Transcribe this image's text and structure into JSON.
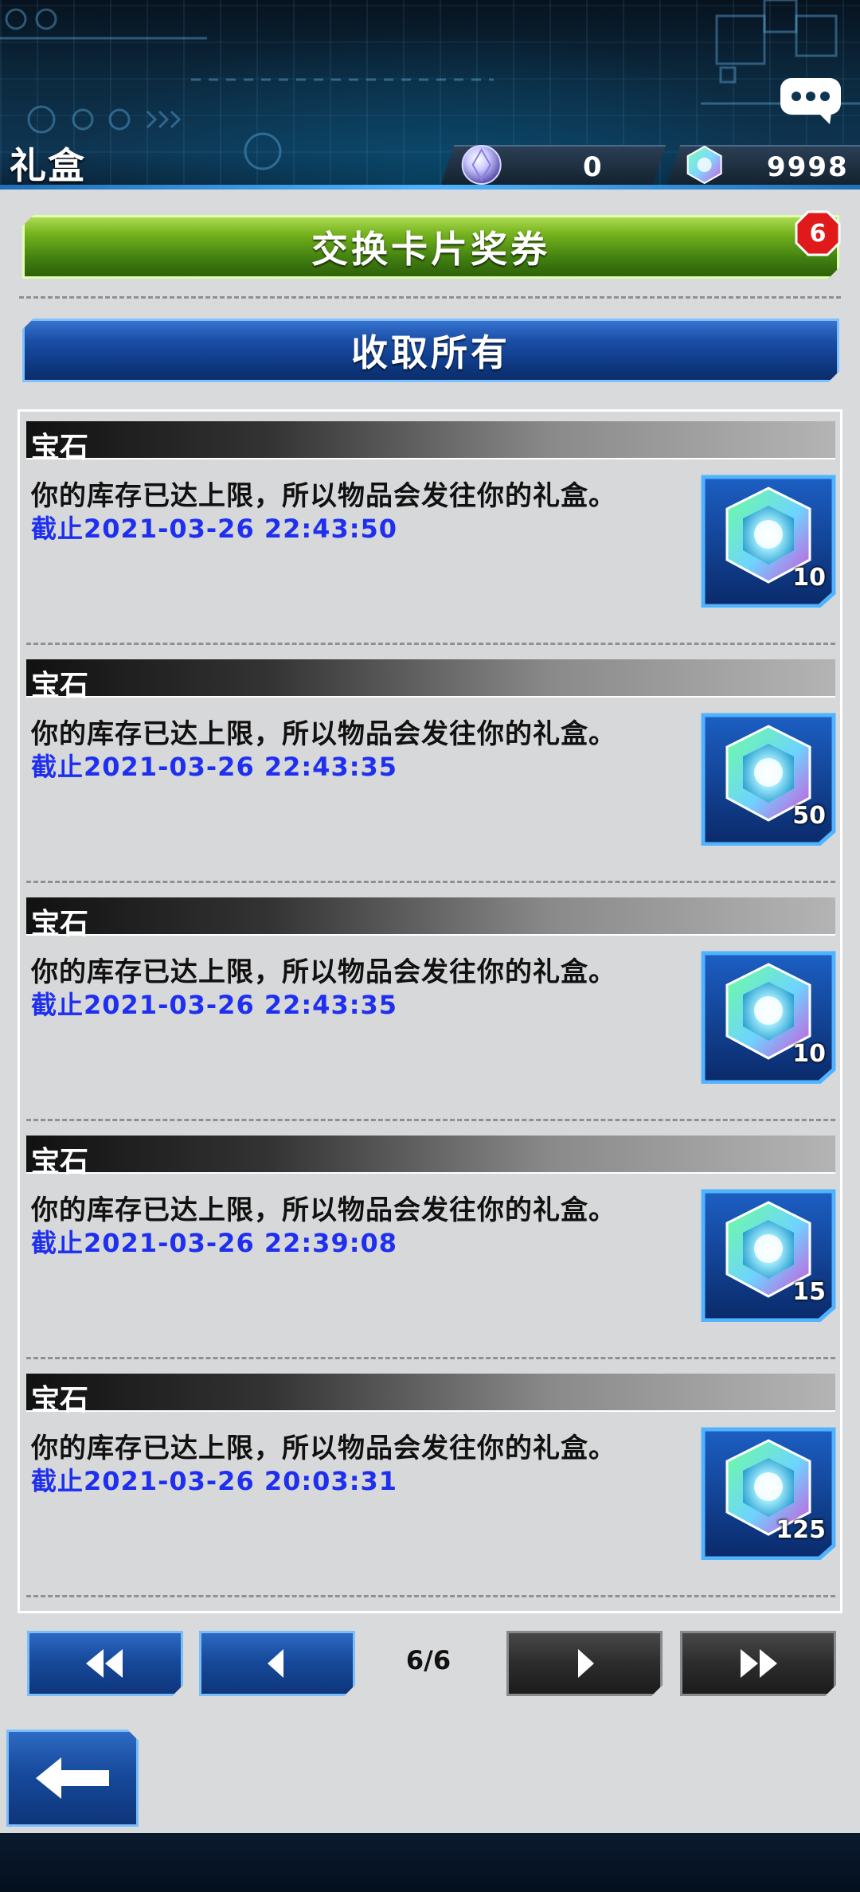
{
  "header": {
    "title": "礼盒",
    "currencies": [
      {
        "name": "orb-currency",
        "icon": "silver-orb-icon",
        "value": "0"
      },
      {
        "name": "gem-currency",
        "icon": "gem-icon",
        "value": "9998"
      }
    ],
    "chat_icon": "chat-bubble-icon"
  },
  "actions": {
    "exchange_label": "交换卡片奖券",
    "exchange_badge": "6",
    "collect_all_label": "收取所有"
  },
  "gifts": [
    {
      "title": "宝石",
      "desc": "你的库存已达上限，所以物品会发往你的礼盒。",
      "deadline_prefix": "截止",
      "deadline": "2021-03-26 22:43:50",
      "quantity": "10",
      "icon": "gem-icon"
    },
    {
      "title": "宝石",
      "desc": "你的库存已达上限，所以物品会发往你的礼盒。",
      "deadline_prefix": "截止",
      "deadline": "2021-03-26 22:43:35",
      "quantity": "50",
      "icon": "gem-icon"
    },
    {
      "title": "宝石",
      "desc": "你的库存已达上限，所以物品会发往你的礼盒。",
      "deadline_prefix": "截止",
      "deadline": "2021-03-26 22:43:35",
      "quantity": "10",
      "icon": "gem-icon"
    },
    {
      "title": "宝石",
      "desc": "你的库存已达上限，所以物品会发往你的礼盒。",
      "deadline_prefix": "截止",
      "deadline": "2021-03-26 22:39:08",
      "quantity": "15",
      "icon": "gem-icon"
    },
    {
      "title": "宝石",
      "desc": "你的库存已达上限，所以物品会发往你的礼盒。",
      "deadline_prefix": "截止",
      "deadline": "2021-03-26 20:03:31",
      "quantity": "125",
      "icon": "gem-icon"
    }
  ],
  "pager": {
    "current": "6/6",
    "first_icon": "double-left-arrow-icon",
    "prev_icon": "left-arrow-icon",
    "next_icon": "right-arrow-icon",
    "last_icon": "double-right-arrow-icon"
  },
  "back_icon": "back-arrow-icon",
  "colors": {
    "deadline_text": "#1f2ff0",
    "green_button": "#3f7d10",
    "blue_button": "#174a9c",
    "badge_red": "#e01a1a"
  }
}
